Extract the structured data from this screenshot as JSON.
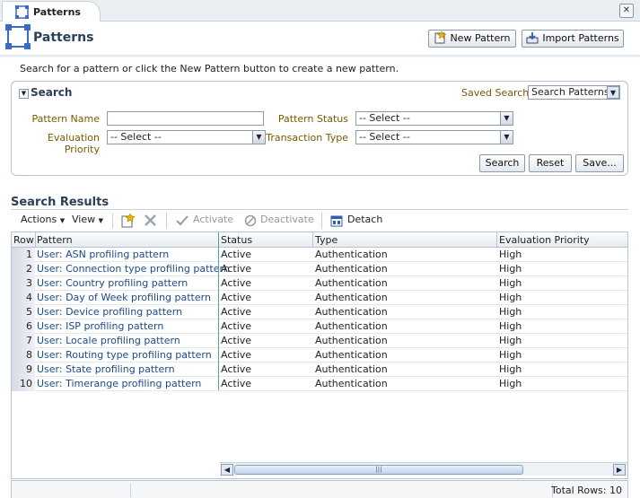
{
  "tab": {
    "label": "Patterns",
    "icon": "patterns-icon",
    "close_icon": "close-icon"
  },
  "header": {
    "title": "Patterns",
    "new_pattern_label": "New Pattern",
    "import_patterns_label": "Import Patterns"
  },
  "help_text": "Search for a pattern or click the New Pattern button to create a new pattern.",
  "search": {
    "title": "Search",
    "saved_search_label": "Saved Search",
    "saved_search_value": "Search Patterns",
    "pattern_name_label": "Pattern Name",
    "pattern_name_value": "",
    "evaluation_priority_label": "Evaluation Priority",
    "evaluation_priority_value": "-- Select --",
    "pattern_status_label": "Pattern Status",
    "pattern_status_value": "-- Select --",
    "transaction_type_label": "Transaction Type",
    "transaction_type_value": "-- Select --",
    "search_button": "Search",
    "reset_button": "Reset",
    "save_button": "Save..."
  },
  "results": {
    "title": "Search Results",
    "toolbar": {
      "actions": "Actions",
      "view": "View",
      "activate": "Activate",
      "deactivate": "Deactivate",
      "detach": "Detach"
    },
    "columns": [
      "Row",
      "Pattern",
      "Status",
      "Type",
      "Evaluation Priority"
    ],
    "rows": [
      {
        "row": "1",
        "pattern": "User: ASN profiling pattern",
        "status": "Active",
        "type": "Authentication",
        "priority": "High"
      },
      {
        "row": "2",
        "pattern": "User: Connection type profiling pattern",
        "status": "Active",
        "type": "Authentication",
        "priority": "High"
      },
      {
        "row": "3",
        "pattern": "User: Country profiling pattern",
        "status": "Active",
        "type": "Authentication",
        "priority": "High"
      },
      {
        "row": "4",
        "pattern": "User: Day of Week profiling pattern",
        "status": "Active",
        "type": "Authentication",
        "priority": "High"
      },
      {
        "row": "5",
        "pattern": "User: Device profiling pattern",
        "status": "Active",
        "type": "Authentication",
        "priority": "High"
      },
      {
        "row": "6",
        "pattern": "User: ISP profiling pattern",
        "status": "Active",
        "type": "Authentication",
        "priority": "High"
      },
      {
        "row": "7",
        "pattern": "User: Locale profiling pattern",
        "status": "Active",
        "type": "Authentication",
        "priority": "High"
      },
      {
        "row": "8",
        "pattern": "User: Routing type profiling pattern",
        "status": "Active",
        "type": "Authentication",
        "priority": "High"
      },
      {
        "row": "9",
        "pattern": "User: State profiling pattern",
        "status": "Active",
        "type": "Authentication",
        "priority": "High"
      },
      {
        "row": "10",
        "pattern": "User: Timerange profiling pattern",
        "status": "Active",
        "type": "Authentication",
        "priority": "High"
      }
    ],
    "total_rows": "Total Rows: 10"
  },
  "colors": {
    "link": "#1a4a8c",
    "label": "#7a5a00",
    "title": "#2b3f5a",
    "accent_line": "#4aa89c"
  }
}
